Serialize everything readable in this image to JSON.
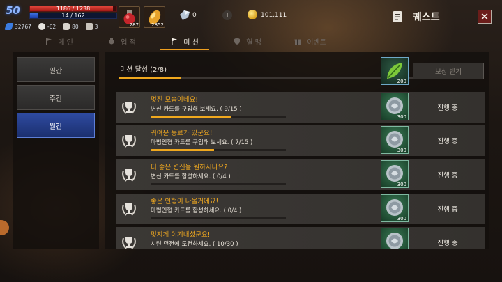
{
  "player": {
    "level": "50",
    "hp": "1186 / 1238",
    "hp_fraction": 0.958,
    "mp": "14 / 162",
    "mp_fraction": 0.086,
    "stats": [
      "32767",
      "-62",
      "80",
      "3"
    ]
  },
  "inventory": {
    "potion_count": "287",
    "elixir_count": "2852",
    "gems": "0",
    "gold": "101,111"
  },
  "header": {
    "title": "퀘스트",
    "close_symbol": "✕"
  },
  "tabs": [
    {
      "label": "메 인",
      "icon": "flag-icon",
      "active": false
    },
    {
      "label": "업 적",
      "icon": "medal-icon",
      "active": false
    },
    {
      "label": "미 션",
      "icon": "flag-icon",
      "active": true
    },
    {
      "label": "혈 맹",
      "icon": "shield-icon",
      "active": false
    },
    {
      "label": "이벤트",
      "icon": "gift-icon",
      "active": false
    }
  ],
  "sidebar": {
    "items": [
      {
        "label": "일간",
        "active": false
      },
      {
        "label": "주간",
        "active": false
      },
      {
        "label": "월간",
        "active": true
      }
    ]
  },
  "mission_progress": {
    "label": "미션 달성 (2/8)",
    "fraction": 0.176,
    "reward_count": "200",
    "claim_label": "보상 받기"
  },
  "missions": [
    {
      "title": "멋진 모습이네요!",
      "desc": "변신 카드를 구입해 보세요. ( 9/15 )",
      "progress": 0.6,
      "reward_count": "300",
      "status": "진행 중"
    },
    {
      "title": "귀여운 동료가 있군요!",
      "desc": "마법인형 카드를 구입해 보세요. ( 7/15 )",
      "progress": 0.467,
      "reward_count": "300",
      "status": "진행 중"
    },
    {
      "title": "더 좋은 변신을 원하시나요?",
      "desc": "변신 카드를 합성하세요. ( 0/4 )",
      "progress": 0.0,
      "reward_count": "300",
      "status": "진행 중"
    },
    {
      "title": "좋은 인형이 나올거에요!",
      "desc": "마법인형 카드를 합성하세요. ( 0/4 )",
      "progress": 0.0,
      "reward_count": "300",
      "status": "진행 중"
    },
    {
      "title": "멋지게 이겨내셨군요!",
      "desc": "시련 던전에 도전하세요. ( 10/30 )",
      "progress": 0.333,
      "reward_count": "300",
      "status": "진행 중"
    }
  ],
  "colors": {
    "accent": "#f0a81e",
    "title_text": "#f0a820",
    "active_side": "#2e4aa0",
    "hp": "#d3342c",
    "mp": "#2f5cd0",
    "close_bg": "#6b1d1a"
  }
}
